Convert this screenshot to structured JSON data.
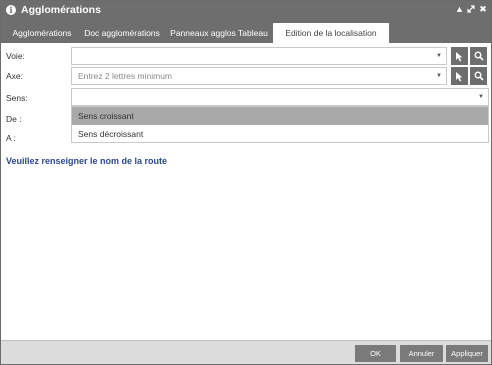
{
  "window": {
    "title": "Agglomérations"
  },
  "tabs": [
    {
      "label": "Agglomérations"
    },
    {
      "label": "Doc agglomérations"
    },
    {
      "label": "Panneaux agglos Tableau"
    },
    {
      "label": "Edition de la localisation"
    }
  ],
  "form": {
    "voie": {
      "label": "Voie:",
      "value": ""
    },
    "axe": {
      "label": "Axe:",
      "placeholder": "Entrez 2 lettres minimum"
    },
    "sens": {
      "label": "Sens:",
      "value": "",
      "options": [
        "Sens croissant",
        "Sens décroissant"
      ],
      "highlighted": "Sens croissant"
    },
    "de": {
      "label": "De :"
    },
    "a": {
      "label": "A :"
    }
  },
  "message": "Veuillez renseigner le nom de la route",
  "footer": {
    "ok": "OK",
    "cancel": "Annuler",
    "apply": "Appliquer"
  },
  "icons": {
    "info": "info-icon",
    "pointer": "cursor-icon",
    "search": "search-icon"
  },
  "colors": {
    "chrome": "#6e6e6e",
    "message": "#2a4a8c",
    "highlight": "#a9a9a9"
  }
}
